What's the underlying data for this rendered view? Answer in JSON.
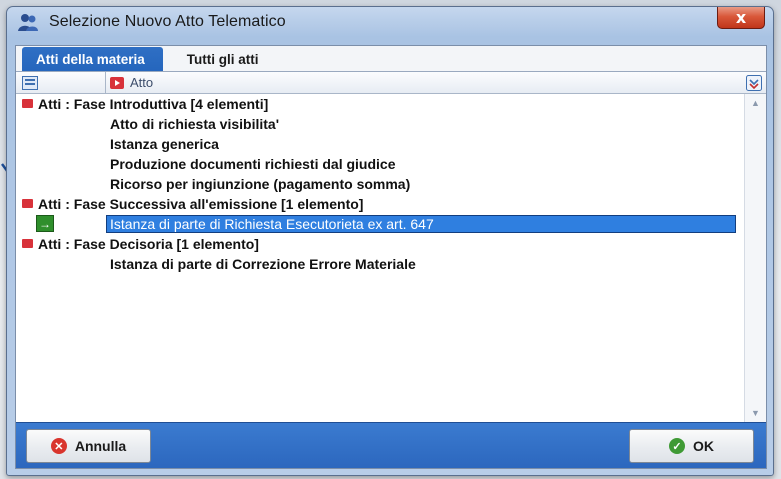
{
  "window": {
    "title": "Selezione Nuovo Atto Telematico",
    "close_glyph": "x"
  },
  "tabs": [
    {
      "label": "Atti della materia",
      "active": true
    },
    {
      "label": "Tutti gli atti",
      "active": false
    }
  ],
  "list_header": {
    "atto_label": "Atto"
  },
  "groups": [
    {
      "label": "Atti : Fase Introduttiva  [4 elementi]",
      "items": [
        "Atto di richiesta visibilita'",
        "Istanza generica",
        "Produzione documenti richiesti dal giudice",
        "Ricorso per ingiunzione (pagamento somma)"
      ]
    },
    {
      "label": "Atti : Fase Successiva all'emissione  [1 elemento]",
      "items": [
        "Istanza di parte di Richiesta Esecutorieta ex art. 647"
      ],
      "selected_item": 0
    },
    {
      "label": "Atti : Fase Decisoria  [1 elemento]",
      "items": [
        "Istanza di parte di Correzione Errore Materiale"
      ]
    }
  ],
  "footer": {
    "cancel_label": "Annulla",
    "ok_label": "OK"
  },
  "colors": {
    "accent": "#2f6fc4",
    "selection": "#2f7fe0",
    "group_bullet": "#d8323a"
  }
}
